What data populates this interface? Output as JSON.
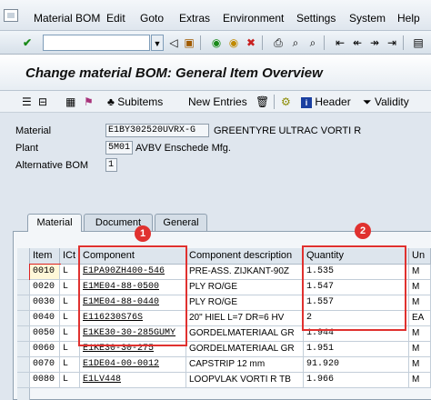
{
  "menu": [
    "Material BOM",
    "Edit",
    "Goto",
    "Extras",
    "Environment",
    "Settings",
    "System",
    "Help"
  ],
  "toolbar": {
    "command_value": "",
    "icons": [
      "check-icon",
      "back-arrow-icon",
      "save-icon",
      "back-icon",
      "exit-icon",
      "cancel-icon",
      "print-icon",
      "find-icon",
      "find-next-icon",
      "first-page-icon",
      "prev-page-icon",
      "next-page-icon",
      "last-page-icon"
    ]
  },
  "title": "Change material BOM: General Item Overview",
  "app_toolbar": {
    "subitems": "Subitems",
    "new_entries": "New Entries",
    "header": "Header",
    "validity": "Validity"
  },
  "header_fields": {
    "material_label": "Material",
    "material_value": "E1BY302520UVRX-G",
    "material_desc": "GREENTYRE  ULTRAC VORTI R",
    "plant_label": "Plant",
    "plant_value": "5M01",
    "plant_desc": "AVBV Enschede Mfg.",
    "altbom_label": "Alternative BOM",
    "altbom_value": "1"
  },
  "tabs": [
    "Material",
    "Document",
    "General"
  ],
  "table": {
    "columns": [
      "Item",
      "ICt",
      "Component",
      "Component description",
      "Quantity",
      "Un"
    ],
    "rows": [
      {
        "item": "0010",
        "ict": "L",
        "component": "E1PA90ZH400-546",
        "desc": "PRE-ASS. ZIJKANT-90Z",
        "qty": "1.535",
        "un": "M"
      },
      {
        "item": "0020",
        "ict": "L",
        "component": "E1ME04-88-0500",
        "desc": "PLY RO/GE",
        "qty": "1.547",
        "un": "M"
      },
      {
        "item": "0030",
        "ict": "L",
        "component": "E1ME04-88-0440",
        "desc": "PLY RO/GE",
        "qty": "1.557",
        "un": "M"
      },
      {
        "item": "0040",
        "ict": "L",
        "component": "E116230S76S",
        "desc": "20\" HIEL  L=7 DR=6 HV",
        "qty": "2",
        "un": "EA"
      },
      {
        "item": "0050",
        "ict": "L",
        "component": "E1KE30-30-285GUMY",
        "desc": "GORDELMATERIAAL GR",
        "qty": "1.944",
        "un": "M"
      },
      {
        "item": "0060",
        "ict": "L",
        "component": "E1KE30-30-275",
        "desc": "GORDELMATERIAAL GR",
        "qty": "1.951",
        "un": "M"
      },
      {
        "item": "0070",
        "ict": "L",
        "component": "E1DE04-00-0012",
        "desc": "CAPSTRIP 12 mm",
        "qty": "91.920",
        "un": "M"
      },
      {
        "item": "0080",
        "ict": "L",
        "component": "E1LV448",
        "desc": "LOOPVLAK VORTI R TB",
        "qty": "1.966",
        "un": "M"
      }
    ]
  },
  "callouts": [
    "1",
    "2"
  ],
  "colors": {
    "callout": "#e0312f",
    "focus": "#d22222"
  }
}
